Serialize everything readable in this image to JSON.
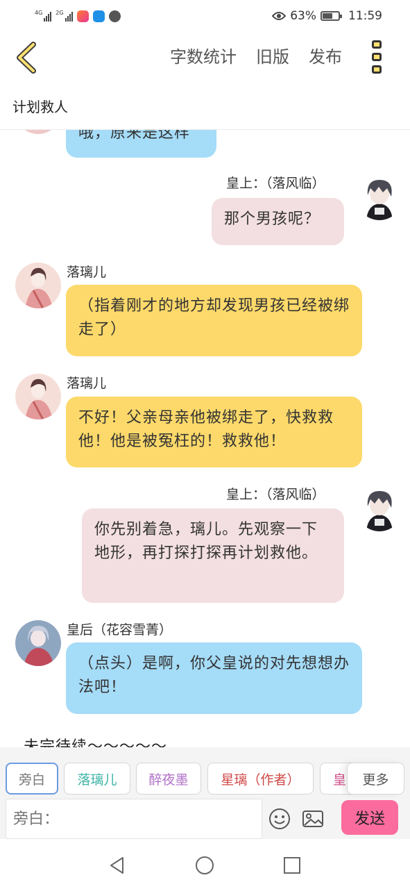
{
  "status_bar": {
    "net1": "4G",
    "net2": "2G",
    "battery_text": "63%",
    "battery_level": 0.63,
    "time": "11:59"
  },
  "nav": {
    "actions": [
      "字数统计",
      "旧版",
      "发布"
    ]
  },
  "page_title": "计划救人",
  "messages": [
    {
      "speaker": "",
      "text": "哦，原来是这样",
      "side": "left",
      "color": "#a5dcf8"
    },
    {
      "speaker": "皇上：（落风临）",
      "text": "那个男孩呢？",
      "side": "right",
      "color": "#f3dfe1"
    },
    {
      "speaker": "落璃儿",
      "text": "（指着刚才的地方却发现男孩已经被绑走了）",
      "side": "left",
      "color": "#fcd96a"
    },
    {
      "speaker": "落璃儿",
      "text": "不好！父亲母亲他被绑走了，快救救他！他是被冤枉的！救救他！",
      "side": "left",
      "color": "#fcd96a"
    },
    {
      "speaker": "皇上：（落风临）",
      "text": "你先别着急，璃儿。先观察一下地形，再打探打探再计划救他。",
      "side": "right",
      "color": "#f3dfe1"
    },
    {
      "speaker": "皇后（花容雪菁）",
      "text": "（点头）是啊，你父皇说的对先想想办法吧！",
      "side": "left",
      "color": "#a5dcf8"
    }
  ],
  "footer_text": "未完待续～～～～～",
  "roles": [
    {
      "label": "旁白",
      "color": "#777777"
    },
    {
      "label": "落璃儿",
      "color": "#3bb3a4"
    },
    {
      "label": "醉夜墨",
      "color": "#b070c8"
    },
    {
      "label": "星璃（作者）",
      "color": "#d04848"
    },
    {
      "label": "皇",
      "color": "#d0508a"
    }
  ],
  "more_label": "更多",
  "input": {
    "placeholder": "旁白："
  },
  "send_label": "发送"
}
